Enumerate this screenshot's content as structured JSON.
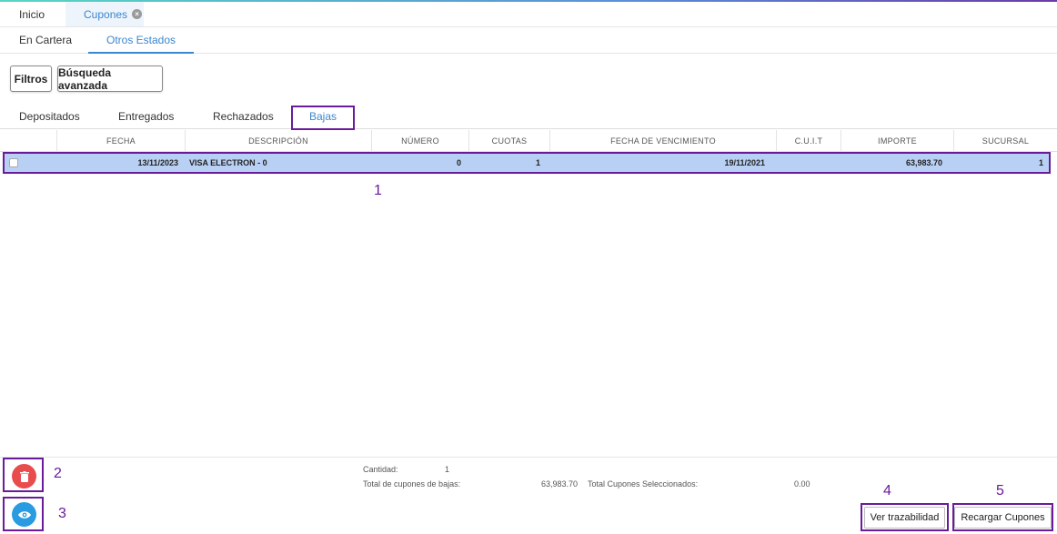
{
  "app_tabs": {
    "inicio": "Inicio",
    "cupones": "Cupones"
  },
  "sub_tabs": {
    "en_cartera": "En Cartera",
    "otros_estados": "Otros Estados"
  },
  "toolbar": {
    "filtros": "Filtros",
    "busqueda": "Búsqueda avanzada"
  },
  "state_tabs": {
    "depositados": "Depositados",
    "entregados": "Entregados",
    "rechazados": "Rechazados",
    "bajas": "Bajas"
  },
  "grid": {
    "columns": [
      "FECHA",
      "DESCRIPCIÓN",
      "NÚMERO",
      "CUOTAS",
      "FECHA DE VENCIMIENTO",
      "C.U.I.T",
      "IMPORTE",
      "SUCURSAL"
    ],
    "rows": [
      {
        "fecha": "13/11/2023",
        "descripcion": "VISA ELECTRON - 0",
        "numero": "0",
        "cuotas": "1",
        "vencimiento": "19/11/2021",
        "cuit": "",
        "importe": "63,983.70",
        "sucursal": "1"
      }
    ]
  },
  "annotations": {
    "a1": "1",
    "a2": "2",
    "a3": "3",
    "a4": "4",
    "a5": "5"
  },
  "summary": {
    "cantidad_label": "Cantidad:",
    "cantidad_value": "1",
    "total_bajas_label": "Total de cupones de bajas:",
    "total_bajas_value": "63,983.70",
    "total_sel_label": "Total Cupones Seleccionados:",
    "total_sel_value": "0.00"
  },
  "actions": {
    "ver_trazabilidad": "Ver trazabilidad",
    "recargar": "Recargar Cupones"
  },
  "icons": {
    "delete": "trash-icon",
    "view": "eye-icon",
    "close_tab": "close-icon"
  },
  "colors": {
    "accent": "#3a86d0",
    "selection": "#b9d0f5",
    "annotation": "#6a1b9a",
    "delete": "#e84c4c",
    "view": "#2a9be0"
  }
}
